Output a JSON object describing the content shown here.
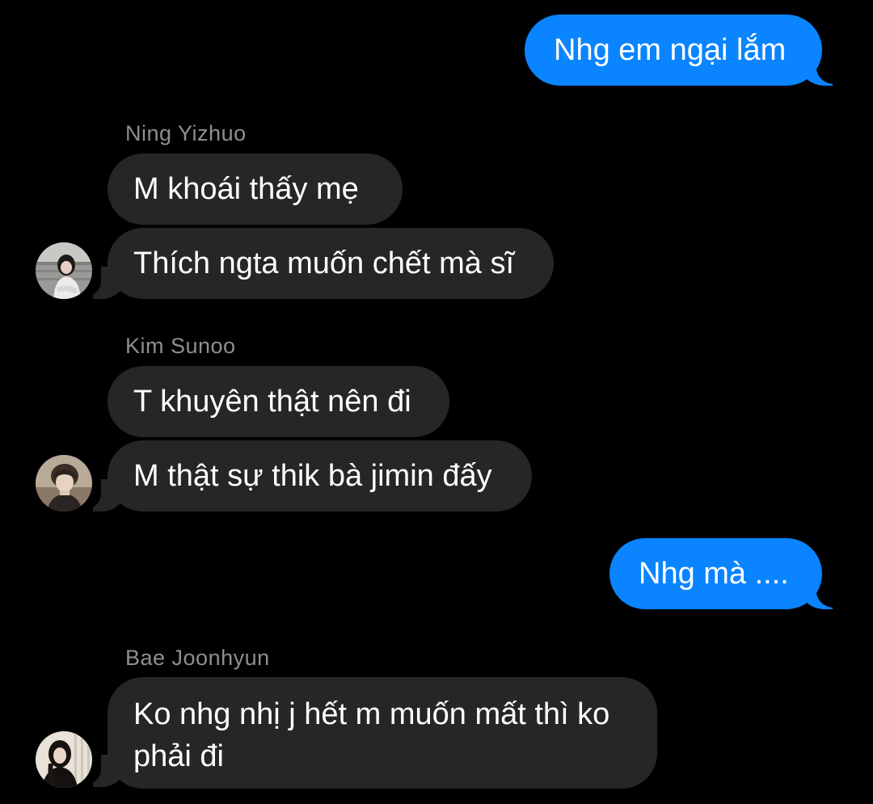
{
  "messages": [
    {
      "side": "out",
      "text": "Nhg em ngại lắm"
    },
    {
      "side": "in",
      "sender": "Ning Yizhuo",
      "text": "M khoái thấy mẹ"
    },
    {
      "side": "in",
      "text": "Thích ngta muốn chết mà sĩ",
      "avatar": "avatar-ning-yizhuo"
    },
    {
      "side": "in",
      "sender": "Kim Sunoo",
      "text": "T khuyên thật nên đi"
    },
    {
      "side": "in",
      "text": "M thật sự thik bà jimin đấy",
      "avatar": "avatar-kim-sunoo"
    },
    {
      "side": "out",
      "text": "Nhg mà ...."
    },
    {
      "side": "in",
      "sender": "Bae Joonhyun",
      "text": "Ko nhg nhị j hết m muốn mất thì ko phải đi",
      "avatar": "avatar-bae-joonhyun"
    }
  ],
  "colors": {
    "background": "#000000",
    "outgoing_bubble": "#0a84ff",
    "incoming_bubble": "#262628",
    "sender_name": "#8e8e93",
    "text": "#ffffff"
  }
}
